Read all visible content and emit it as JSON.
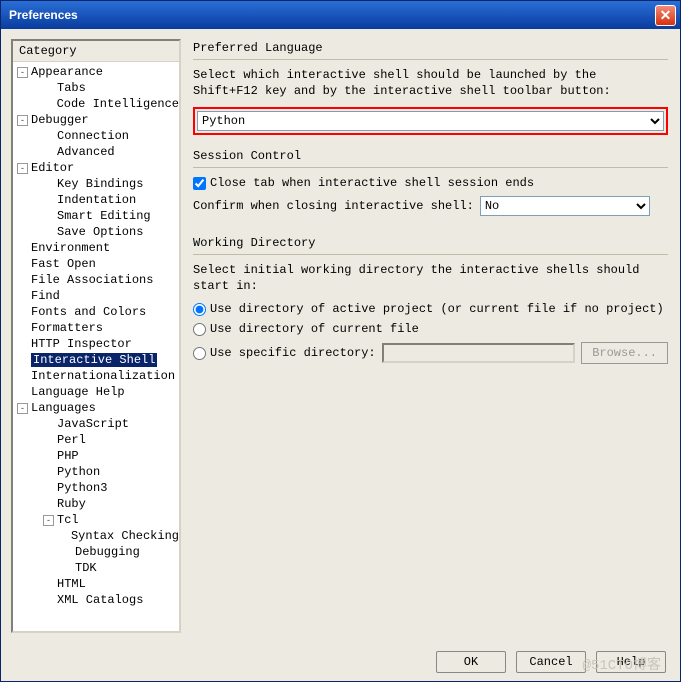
{
  "window": {
    "title": "Preferences"
  },
  "sidebar": {
    "header": "Category",
    "items": [
      {
        "label": "Appearance",
        "level": 1,
        "exp": "-"
      },
      {
        "label": "Tabs",
        "level": 2
      },
      {
        "label": "Code Intelligence",
        "level": 2
      },
      {
        "label": "Debugger",
        "level": 1,
        "exp": "-"
      },
      {
        "label": "Connection",
        "level": 2
      },
      {
        "label": "Advanced",
        "level": 2
      },
      {
        "label": "Editor",
        "level": 1,
        "exp": "-"
      },
      {
        "label": "Key Bindings",
        "level": 2
      },
      {
        "label": "Indentation",
        "level": 2
      },
      {
        "label": "Smart Editing",
        "level": 2
      },
      {
        "label": "Save Options",
        "level": 2
      },
      {
        "label": "Environment",
        "level": 1
      },
      {
        "label": "Fast Open",
        "level": 1
      },
      {
        "label": "File Associations",
        "level": 1
      },
      {
        "label": "Find",
        "level": 1
      },
      {
        "label": "Fonts and Colors",
        "level": 1
      },
      {
        "label": "Formatters",
        "level": 1
      },
      {
        "label": "HTTP Inspector",
        "level": 1
      },
      {
        "label": "Interactive Shell",
        "level": 1,
        "selected": true
      },
      {
        "label": "Internationalization",
        "level": 1
      },
      {
        "label": "Language Help",
        "level": 1
      },
      {
        "label": "Languages",
        "level": 1,
        "exp": "-"
      },
      {
        "label": "JavaScript",
        "level": 2
      },
      {
        "label": "Perl",
        "level": 2
      },
      {
        "label": "PHP",
        "level": 2
      },
      {
        "label": "Python",
        "level": 2
      },
      {
        "label": "Python3",
        "level": 2
      },
      {
        "label": "Ruby",
        "level": 2
      },
      {
        "label": "Tcl",
        "level": 2,
        "exp": "-",
        "hasExp": true
      },
      {
        "label": "Syntax Checking",
        "level": 3
      },
      {
        "label": "Debugging",
        "level": 3
      },
      {
        "label": "TDK",
        "level": 3
      },
      {
        "label": "HTML",
        "level": 2
      },
      {
        "label": "XML Catalogs",
        "level": 2
      }
    ]
  },
  "preferred_language": {
    "title": "Preferred Language",
    "desc": "Select which interactive shell should be launched by the Shift+F12 key and by the interactive shell toolbar button:",
    "value": "Python"
  },
  "session_control": {
    "title": "Session Control",
    "close_tab": "Close tab when interactive shell session ends",
    "confirm_label": "Confirm when closing interactive shell:",
    "confirm_value": "No"
  },
  "working_dir": {
    "title": "Working Directory",
    "desc": "Select initial working directory the interactive shells should start in:",
    "opt1": "Use directory of active project (or current file if no project)",
    "opt2": "Use directory of current file",
    "opt3": "Use specific directory:",
    "browse": "Browse..."
  },
  "footer": {
    "ok": "OK",
    "cancel": "Cancel",
    "help": "Help"
  },
  "watermark": "@51CTO博客"
}
